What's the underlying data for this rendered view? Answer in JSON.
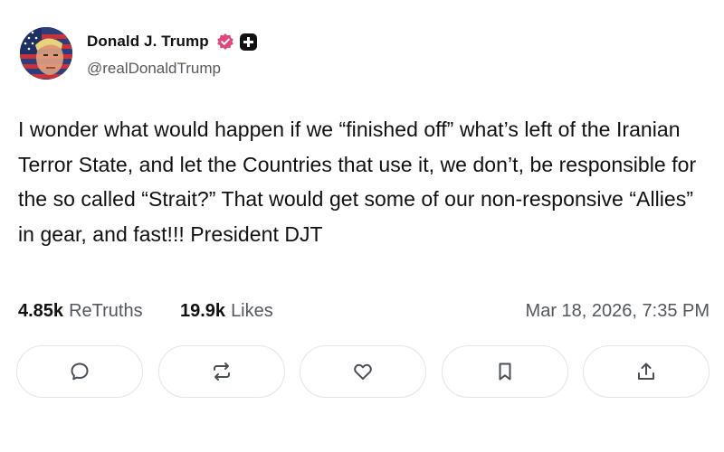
{
  "author": {
    "display_name": "Donald J. Trump",
    "handle": "@realDonaldTrump",
    "avatar_icon": "flag-portrait-avatar",
    "verified_badge_color": "#e0457b"
  },
  "post": {
    "text": "I wonder what would happen if we “finished off” what’s left of the Iranian Terror State, and let the Countries that use it, we don’t, be responsible for the so called “Strait?” That would get some of our non-responsive “Allies” in gear, and fast!!! President DJT"
  },
  "stats": {
    "retruths_count": "4.85k",
    "retruths_label": "ReTruths",
    "likes_count": "19.9k",
    "likes_label": "Likes",
    "timestamp": "Mar 18, 2026, 7:35 PM"
  },
  "actions": [
    {
      "name": "reply",
      "icon": "comment-icon"
    },
    {
      "name": "retruth",
      "icon": "repost-icon"
    },
    {
      "name": "like",
      "icon": "heart-icon"
    },
    {
      "name": "bookmark",
      "icon": "bookmark-icon"
    },
    {
      "name": "share",
      "icon": "share-icon"
    }
  ],
  "colors": {
    "text": "#111111",
    "muted": "#53575e",
    "border": "#e2e4e8",
    "icon": "#4a4f57"
  }
}
